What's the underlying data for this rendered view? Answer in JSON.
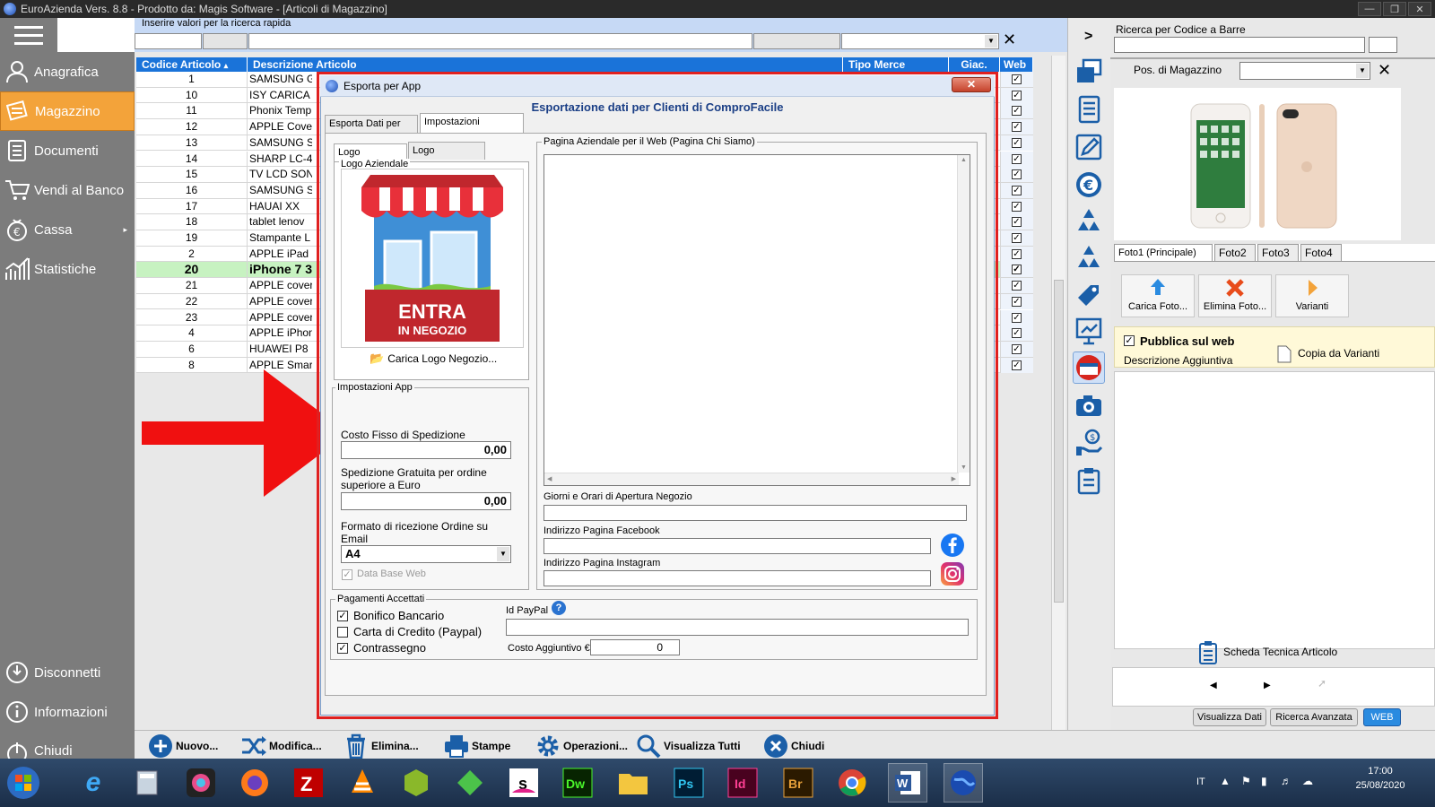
{
  "window": {
    "title": "EuroAzienda Vers. 8.8 - Prodotto da: Magis Software - [Articoli di Magazzino]"
  },
  "sidebar": {
    "items": [
      {
        "label": "Anagrafica",
        "icon": "person-icon"
      },
      {
        "label": "Magazzino",
        "icon": "warehouse-icon"
      },
      {
        "label": "Documenti",
        "icon": "documents-icon"
      },
      {
        "label": "Vendi al Banco",
        "icon": "cart-icon"
      },
      {
        "label": "Cassa",
        "icon": "cash-register-icon"
      },
      {
        "label": "Statistiche",
        "icon": "stats-icon"
      },
      {
        "label": "Disconnetti",
        "icon": "power-icon"
      },
      {
        "label": "Informazioni",
        "icon": "info-icon"
      },
      {
        "label": "Chiudi",
        "icon": "close-app-icon"
      }
    ]
  },
  "search": {
    "label": "Inserire valori per la ricerca rapida"
  },
  "grid": {
    "columns": [
      "Codice Articolo",
      "Descrizione Articolo",
      "Tipo Merce",
      "Giac.",
      "Web"
    ],
    "rows": [
      {
        "code": "1",
        "desc": "SAMSUNG G"
      },
      {
        "code": "10",
        "desc": "ISY CARICA"
      },
      {
        "code": "11",
        "desc": "Phonix Temp"
      },
      {
        "code": "12",
        "desc": "APPLE Cove"
      },
      {
        "code": "13",
        "desc": "SAMSUNG S"
      },
      {
        "code": "14",
        "desc": "SHARP LC-4"
      },
      {
        "code": "15",
        "desc": "TV LCD SON"
      },
      {
        "code": "16",
        "desc": "SAMSUNG S"
      },
      {
        "code": "17",
        "desc": "HAUAI XX"
      },
      {
        "code": "18",
        "desc": "tablet lenov"
      },
      {
        "code": "19",
        "desc": "Stampante L"
      },
      {
        "code": "2",
        "desc": "APPLE iPad"
      },
      {
        "code": "20",
        "desc": "iPhone 7 3"
      },
      {
        "code": "21",
        "desc": "APPLE cover"
      },
      {
        "code": "22",
        "desc": "APPLE cover"
      },
      {
        "code": "23",
        "desc": "APPLE cover"
      },
      {
        "code": "4",
        "desc": "APPLE iPhon"
      },
      {
        "code": "6",
        "desc": "HUAWEI P8"
      },
      {
        "code": "8",
        "desc": "APPLE Smar"
      }
    ]
  },
  "dialog": {
    "title": "Esporta per App",
    "heading": "Esportazione dati per Clienti di ComproFacile",
    "tabs": [
      "Esporta Dati per App",
      "Impostazioni Aziendali"
    ],
    "logo_tabs": [
      "Logo Aziendale",
      "Logo Orizzontale"
    ],
    "logo_group": "Logo Aziendale",
    "logo_text1": "ENTRA",
    "logo_text2": "IN NEGOZIO",
    "load_logo": "Carica Logo Negozio...",
    "app_group": "Impostazioni App",
    "shipping_label": "Costo Fisso di Spedizione",
    "shipping_value": "0,00",
    "free_label": "Spedizione Gratuita per ordine superiore a Euro",
    "free_value": "0,00",
    "format_label": "Formato di ricezione Ordine su Email",
    "format_value": "A4",
    "database_label": "Data Base Web",
    "page_label": "Pagina Aziendale per il Web (Pagina Chi Siamo)",
    "hours_label": "Giorni e Orari di Apertura Negozio",
    "facebook_label": "Indirizzo Pagina Facebook",
    "instagram_label": "Indirizzo Pagina Instagram",
    "payments_group": "Pagamenti Accettati",
    "pay_bank": "Bonifico Bancario",
    "pay_card": "Carta di Credito (Paypal)",
    "pay_cod": "Contrassegno",
    "paypal_label": "Id PayPal",
    "extra_cost_label": "Costo Aggiuntivo €.",
    "extra_cost_value": "0"
  },
  "right_panel": {
    "barcode_label": "Ricerca per Codice a Barre",
    "position_label": "Pos. di Magazzino",
    "photo_tabs": [
      "Foto1 (Principale)",
      "Foto2",
      "Foto3",
      "Foto4"
    ],
    "buttons": [
      "Carica Foto...",
      "Elimina Foto...",
      "Varianti"
    ],
    "publish_label": "Pubblica sul web",
    "copy_label": "Copia da Varianti",
    "desc_label": "Descrizione Aggiuntiva",
    "tech_sheet": "Scheda Tecnica Articolo",
    "bottom_tabs": [
      "Visualizza Dati",
      "Ricerca Avanzata",
      "WEB"
    ],
    "toggle": ">"
  },
  "toolbar": {
    "buttons": [
      "Nuovo...",
      "Modifica...",
      "Elimina...",
      "Stampe",
      "Operazioni...",
      "Visualizza Tutti",
      "Chiudi"
    ]
  },
  "taskbar": {
    "lang": "IT",
    "time": "17:00",
    "date": "25/08/2020"
  },
  "colors": {
    "accent": "#1a73d9",
    "active_nav": "#f3a33a",
    "sidebar": "#7c7c7c",
    "highlight": "#e02020"
  }
}
